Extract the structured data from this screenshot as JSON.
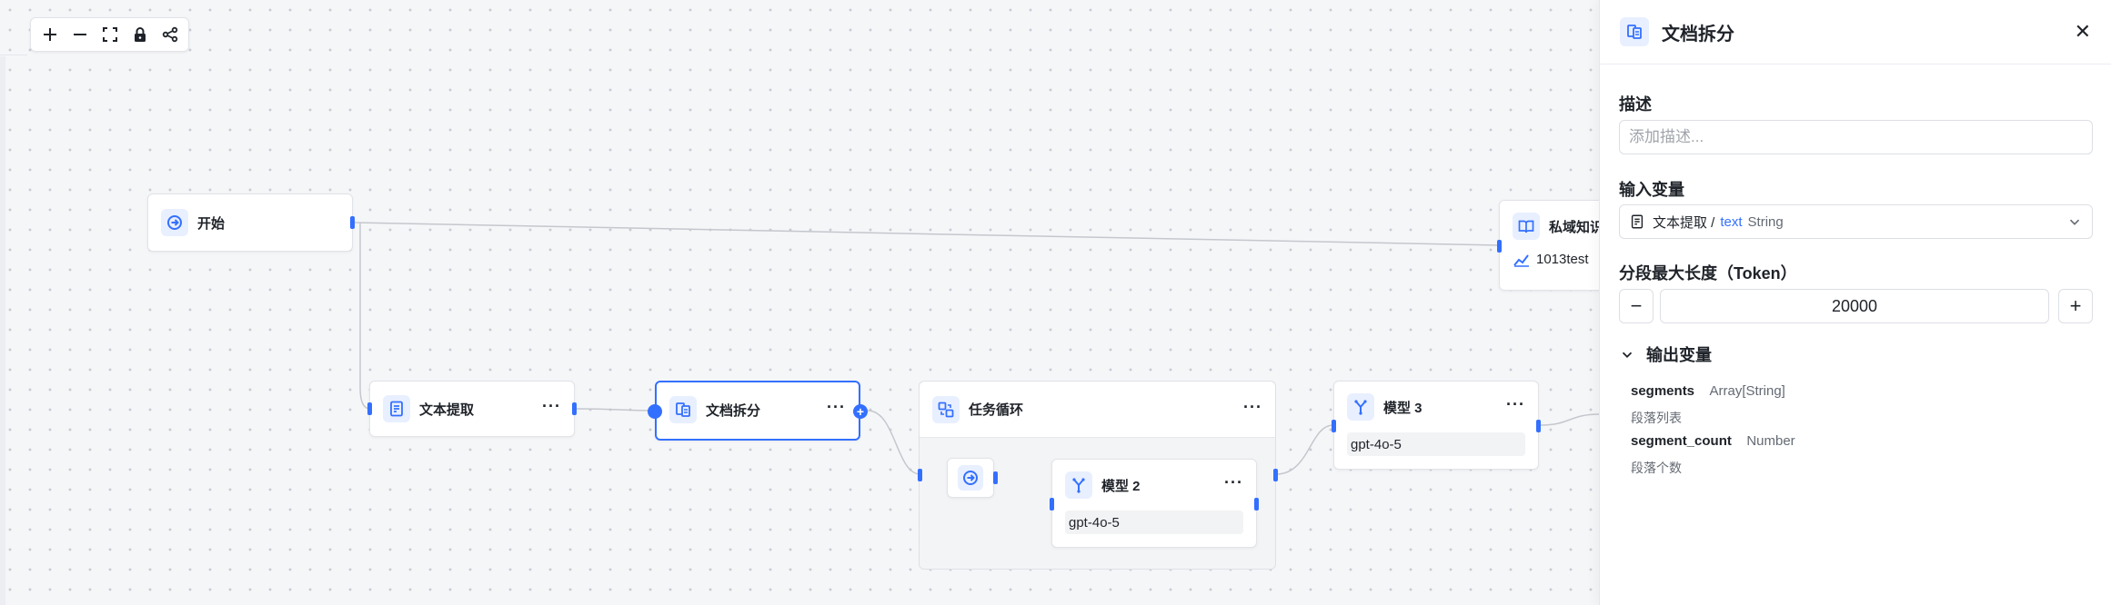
{
  "toolbar": {
    "buttons": [
      "zoom-in",
      "zoom-out",
      "fit-view",
      "lock",
      "layout"
    ]
  },
  "nodes": {
    "start": {
      "title": "开始"
    },
    "text_extract": {
      "title": "文本提取"
    },
    "doc_split": {
      "title": "文档拆分"
    },
    "task_loop": {
      "title": "任务循环"
    },
    "model2": {
      "title": "模型 2",
      "model": "gpt-4o-5"
    },
    "model3": {
      "title": "模型 3",
      "model": "gpt-4o-5"
    },
    "knowledge": {
      "title": "私域知识",
      "sub": "1013test"
    }
  },
  "panel": {
    "title": "文档拆分",
    "desc_label": "描述",
    "desc_placeholder": "添加描述...",
    "input_label": "输入变量",
    "input_source": "文本提取 /",
    "input_var": "text",
    "input_type": "String",
    "maxlen_label": "分段最大长度（Token）",
    "maxlen_value": "20000",
    "output_label": "输出变量",
    "outputs": [
      {
        "name": "segments",
        "type": "Array[String]",
        "desc": "段落列表"
      },
      {
        "name": "segment_count",
        "type": "Number",
        "desc": "段落个数"
      }
    ]
  },
  "colors": {
    "accent": "#3370ff",
    "canvas": "#f5f6f8"
  }
}
